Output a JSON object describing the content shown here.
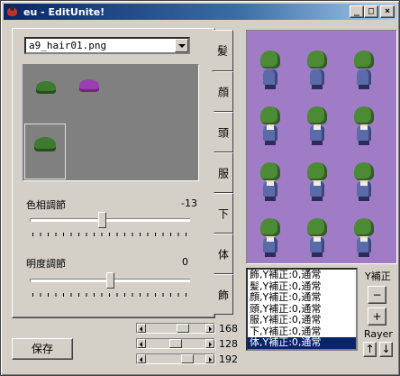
{
  "window": {
    "title": "eu - EditUnite!",
    "minimize": "_",
    "maximize": "□",
    "close": "×"
  },
  "file_select": {
    "value": "a9_hair01.png"
  },
  "hue": {
    "label": "色相調節",
    "value": "-13",
    "level": 0.45
  },
  "brightness": {
    "label": "明度調節",
    "value": "0",
    "level": 0.5
  },
  "tabs": [
    "髪",
    "顔",
    "頭",
    "服",
    "下",
    "体",
    "飾"
  ],
  "layers": [
    "飾,Y補正:0,通常",
    "髪,Y補正:0,通常",
    "顔,Y補正:0,通常",
    "頭,Y補正:0,通常",
    "服,Y補正:0,通常",
    "下,Y補正:0,通常",
    "体,Y補正:0,通常"
  ],
  "selected_layer": 6,
  "y_offset": {
    "label": "Y補正",
    "minus": "−",
    "plus": "+"
  },
  "rayer": {
    "label": "Rayer",
    "up": "↑",
    "down": "↓"
  },
  "save_button": "保存",
  "rgb": [
    {
      "value": "168",
      "level": 0.66
    },
    {
      "value": "128",
      "level": 0.5
    },
    {
      "value": "192",
      "level": 0.75
    }
  ],
  "colors": {
    "preview_bg": "#a07cc6",
    "hair": "#4c8a36",
    "selection": "#0a246a"
  }
}
